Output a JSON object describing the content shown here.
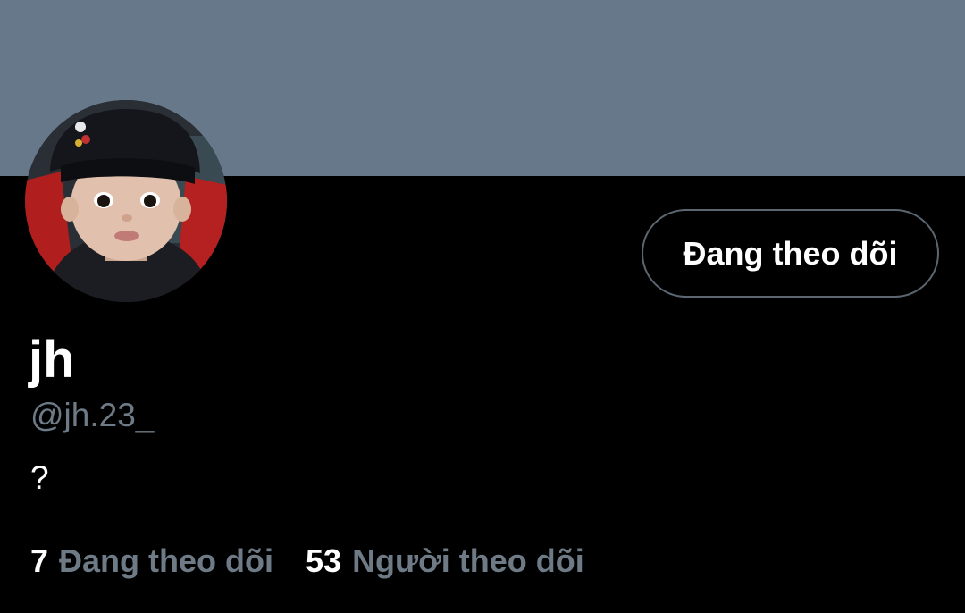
{
  "banner": {
    "color": "#66788a"
  },
  "profile": {
    "display_name": "jh",
    "handle": "@jh.23_",
    "bio": "?"
  },
  "follow_button": {
    "label": "Đang theo dõi"
  },
  "stats": {
    "following_count": "7",
    "following_label": "Đang theo dõi",
    "followers_count": "53",
    "followers_label": "Người theo dõi"
  },
  "colors": {
    "background": "#000000",
    "secondary_text": "#6e7b87",
    "button_border": "#5b6670"
  }
}
